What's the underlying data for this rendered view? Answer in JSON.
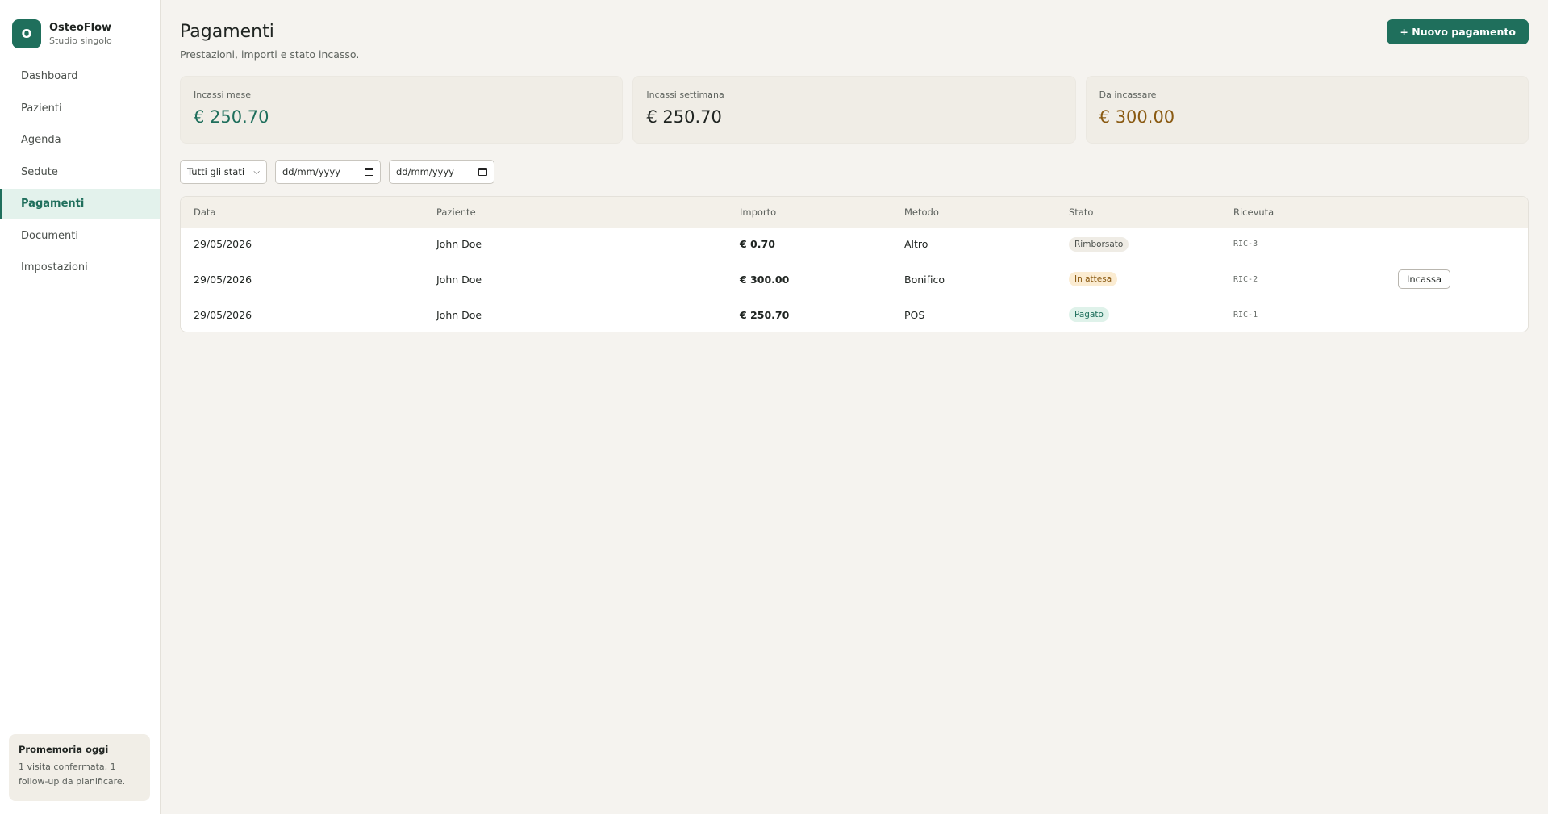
{
  "brand": {
    "initial": "O",
    "name": "OsteoFlow",
    "subtitle": "Studio singolo"
  },
  "nav": [
    {
      "label": "Dashboard",
      "active": false
    },
    {
      "label": "Pazienti",
      "active": false
    },
    {
      "label": "Agenda",
      "active": false
    },
    {
      "label": "Sedute",
      "active": false
    },
    {
      "label": "Pagamenti",
      "active": true
    },
    {
      "label": "Documenti",
      "active": false
    },
    {
      "label": "Impostazioni",
      "active": false
    }
  ],
  "reminder": {
    "title": "Promemoria oggi",
    "body": "1 visita confermata, 1 follow-up da pianificare."
  },
  "header": {
    "title": "Pagamenti",
    "subtitle": "Prestazioni, importi e stato incasso.",
    "new_button": "+ Nuovo pagamento"
  },
  "stats": [
    {
      "label": "Incassi mese",
      "value": "€ 250.70",
      "color": "#1f6f5c"
    },
    {
      "label": "Incassi settimana",
      "value": "€ 250.70",
      "color": "#1f2421"
    },
    {
      "label": "Da incassare",
      "value": "€ 300.00",
      "color": "#8a5a12"
    }
  ],
  "filters": {
    "status_selected": "Tutti gli stati",
    "date_from_placeholder": "dd/mm/yyyy",
    "date_to_placeholder": "dd/mm/yyyy"
  },
  "table": {
    "columns": [
      "Data",
      "Paziente",
      "Importo",
      "Metodo",
      "Stato",
      "Ricevuta",
      ""
    ],
    "rows": [
      {
        "date": "29/05/2026",
        "patient": "John Doe",
        "amount": "€ 0.70",
        "method": "Altro",
        "status": "Rimborsato",
        "receipt": "RIC-3",
        "action": ""
      },
      {
        "date": "29/05/2026",
        "patient": "John Doe",
        "amount": "€ 300.00",
        "method": "Bonifico",
        "status": "In attesa",
        "receipt": "RIC-2",
        "action": "Incassa"
      },
      {
        "date": "29/05/2026",
        "patient": "John Doe",
        "amount": "€ 250.70",
        "method": "POS",
        "status": "Pagato",
        "receipt": "RIC-1",
        "action": ""
      }
    ]
  },
  "icons": {
    "select_chevron": "chevron-down-icon",
    "date_picker": "calendar-icon"
  }
}
